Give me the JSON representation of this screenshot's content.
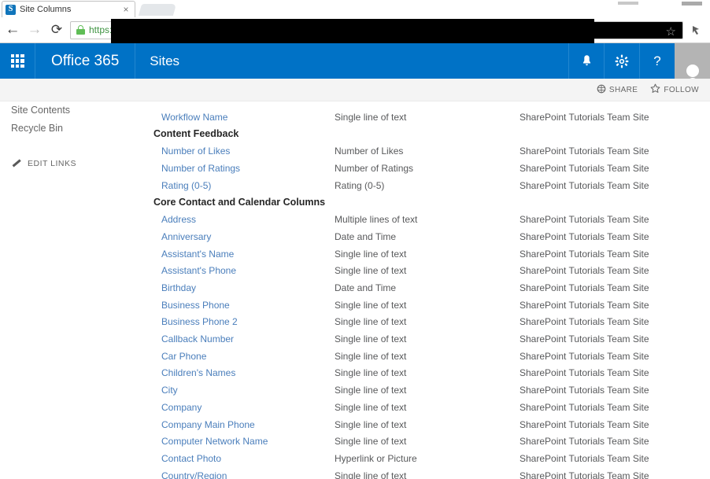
{
  "browser": {
    "tab_title": "Site Columns",
    "tab_favicon": "sharepoint-favicon",
    "tab_close": "×",
    "back": "←",
    "forward": "→",
    "reload": "⟳",
    "url_scheme": "https:",
    "url_redacted": "",
    "star": "☆",
    "extension": "ᵔ",
    "window_min": "",
    "window_close": ""
  },
  "suitebar": {
    "waffle": "app-launcher",
    "brand": "Office 365",
    "site": "Sites",
    "notifications_icon": "🔔",
    "settings_icon": "⚙",
    "help_icon": "?",
    "avatar": "user-avatar"
  },
  "commandbar": {
    "share_icon": "⧉",
    "share_label": "SHARE",
    "follow_icon": "☆",
    "follow_label": "FOLLOW"
  },
  "leftnav": {
    "items": [
      {
        "label": "Site Contents"
      },
      {
        "label": "Recycle Bin"
      }
    ],
    "edit_links": "EDIT LINKS"
  },
  "colors": {
    "suitebar_blue": "#0072C6",
    "link_blue": "#4A7EBB",
    "text_gray": "#58595B",
    "commandbar_bg": "#F4F4F4"
  },
  "list": {
    "rows": [
      {
        "kind": "item",
        "name": "",
        "type": "",
        "source": ""
      },
      {
        "kind": "item",
        "name": "Workflow Name",
        "type": "Single line of text",
        "source": "SharePoint Tutorials Team Site"
      },
      {
        "kind": "group",
        "name": "Content Feedback",
        "type": "",
        "source": ""
      },
      {
        "kind": "item",
        "name": "Number of Likes",
        "type": "Number of Likes",
        "source": "SharePoint Tutorials Team Site"
      },
      {
        "kind": "item",
        "name": "Number of Ratings",
        "type": "Number of Ratings",
        "source": "SharePoint Tutorials Team Site"
      },
      {
        "kind": "item",
        "name": "Rating (0-5)",
        "type": "Rating (0-5)",
        "source": "SharePoint Tutorials Team Site"
      },
      {
        "kind": "group",
        "name": "Core Contact and Calendar Columns",
        "type": "",
        "source": ""
      },
      {
        "kind": "item",
        "name": "Address",
        "type": "Multiple lines of text",
        "source": "SharePoint Tutorials Team Site"
      },
      {
        "kind": "item",
        "name": "Anniversary",
        "type": "Date and Time",
        "source": "SharePoint Tutorials Team Site"
      },
      {
        "kind": "item",
        "name": "Assistant's Name",
        "type": "Single line of text",
        "source": "SharePoint Tutorials Team Site"
      },
      {
        "kind": "item",
        "name": "Assistant's Phone",
        "type": "Single line of text",
        "source": "SharePoint Tutorials Team Site"
      },
      {
        "kind": "item",
        "name": "Birthday",
        "type": "Date and Time",
        "source": "SharePoint Tutorials Team Site"
      },
      {
        "kind": "item",
        "name": "Business Phone",
        "type": "Single line of text",
        "source": "SharePoint Tutorials Team Site"
      },
      {
        "kind": "item",
        "name": "Business Phone 2",
        "type": "Single line of text",
        "source": "SharePoint Tutorials Team Site"
      },
      {
        "kind": "item",
        "name": "Callback Number",
        "type": "Single line of text",
        "source": "SharePoint Tutorials Team Site"
      },
      {
        "kind": "item",
        "name": "Car Phone",
        "type": "Single line of text",
        "source": "SharePoint Tutorials Team Site"
      },
      {
        "kind": "item",
        "name": "Children's Names",
        "type": "Single line of text",
        "source": "SharePoint Tutorials Team Site"
      },
      {
        "kind": "item",
        "name": "City",
        "type": "Single line of text",
        "source": "SharePoint Tutorials Team Site"
      },
      {
        "kind": "item",
        "name": "Company",
        "type": "Single line of text",
        "source": "SharePoint Tutorials Team Site"
      },
      {
        "kind": "item",
        "name": "Company Main Phone",
        "type": "Single line of text",
        "source": "SharePoint Tutorials Team Site"
      },
      {
        "kind": "item",
        "name": "Computer Network Name",
        "type": "Single line of text",
        "source": "SharePoint Tutorials Team Site"
      },
      {
        "kind": "item",
        "name": "Contact Photo",
        "type": "Hyperlink or Picture",
        "source": "SharePoint Tutorials Team Site"
      },
      {
        "kind": "item",
        "name": "Country/Region",
        "type": "Single line of text",
        "source": "SharePoint Tutorials Team Site"
      }
    ]
  }
}
